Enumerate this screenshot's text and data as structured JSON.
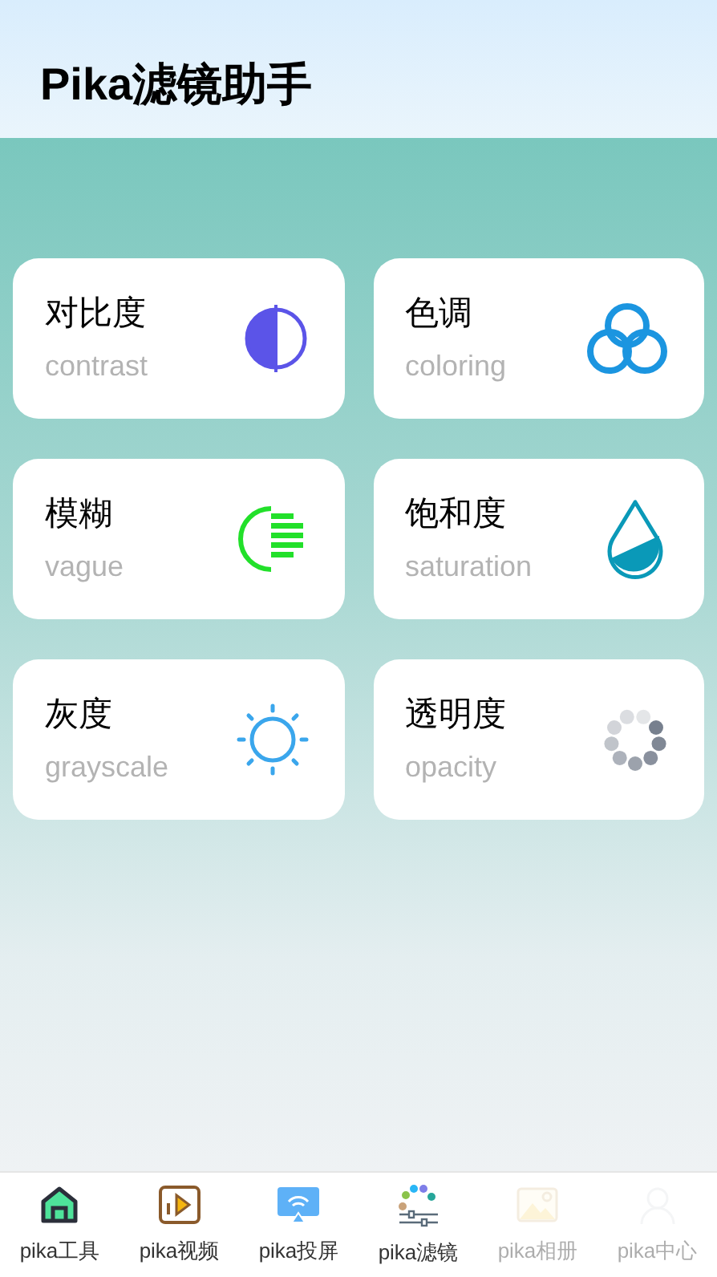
{
  "header": {
    "title": "Pika滤镜助手"
  },
  "filters": [
    {
      "title": "对比度",
      "subtitle": "contrast",
      "kind": "contrast"
    },
    {
      "title": "色调",
      "subtitle": "coloring",
      "kind": "rings"
    },
    {
      "title": "模糊",
      "subtitle": "vague",
      "kind": "blur"
    },
    {
      "title": "饱和度",
      "subtitle": "saturation",
      "kind": "drop"
    },
    {
      "title": "灰度",
      "subtitle": "grayscale",
      "kind": "sun"
    },
    {
      "title": "透明度",
      "subtitle": "opacity",
      "kind": "spinner"
    }
  ],
  "tab_bar": [
    {
      "label": "pika工具",
      "kind": "home",
      "disabled": false
    },
    {
      "label": "pika视频",
      "kind": "video",
      "disabled": false
    },
    {
      "label": "pika投屏",
      "kind": "cast",
      "disabled": false
    },
    {
      "label": "pika滤镜",
      "kind": "filter",
      "disabled": false
    },
    {
      "label": "pika相册",
      "kind": "image",
      "disabled": true
    },
    {
      "label": "pika中心",
      "kind": "user",
      "disabled": true
    }
  ]
}
